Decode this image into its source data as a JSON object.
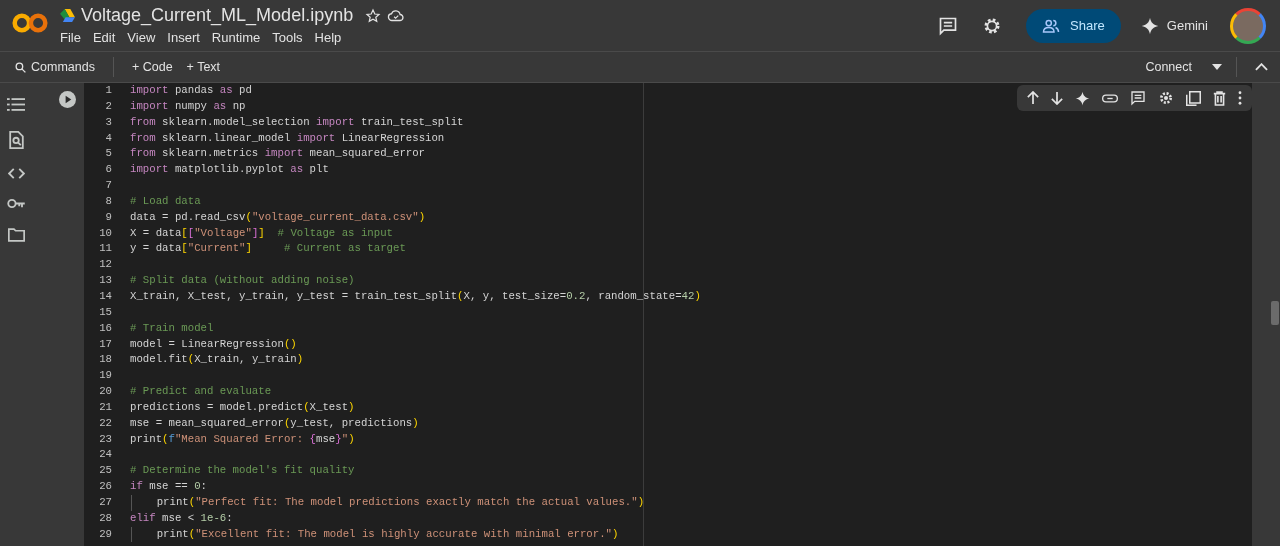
{
  "header": {
    "title": "Voltage_Current_ML_Model.ipynb",
    "menu": [
      "File",
      "Edit",
      "View",
      "Insert",
      "Runtime",
      "Tools",
      "Help"
    ],
    "share_label": "Share",
    "gemini_label": "Gemini"
  },
  "toolbar": {
    "commands_label": "Commands",
    "add_buttons": [
      "+ Code",
      "+ Text"
    ],
    "connect_label": "Connect"
  },
  "cell": {
    "lines": [
      {
        "number": "1",
        "tokens": [
          {
            "kind": "kw",
            "text": "import"
          },
          {
            "kind": "tx",
            "text": " pandas "
          },
          {
            "kind": "kw",
            "text": "as"
          },
          {
            "kind": "tx",
            "text": " pd"
          }
        ]
      },
      {
        "number": "2",
        "tokens": [
          {
            "kind": "kw",
            "text": "import"
          },
          {
            "kind": "tx",
            "text": " numpy "
          },
          {
            "kind": "kw",
            "text": "as"
          },
          {
            "kind": "tx",
            "text": " np"
          }
        ]
      },
      {
        "number": "3",
        "tokens": [
          {
            "kind": "kw",
            "text": "from"
          },
          {
            "kind": "tx",
            "text": " sklearn.model_selection "
          },
          {
            "kind": "kw",
            "text": "import"
          },
          {
            "kind": "tx",
            "text": " train_test_split"
          }
        ]
      },
      {
        "number": "4",
        "tokens": [
          {
            "kind": "kw",
            "text": "from"
          },
          {
            "kind": "tx",
            "text": " sklearn.linear_model "
          },
          {
            "kind": "kw",
            "text": "import"
          },
          {
            "kind": "tx",
            "text": " LinearRegression"
          }
        ]
      },
      {
        "number": "5",
        "tokens": [
          {
            "kind": "kw",
            "text": "from"
          },
          {
            "kind": "tx",
            "text": " sklearn.metrics "
          },
          {
            "kind": "kw",
            "text": "import"
          },
          {
            "kind": "tx",
            "text": " mean_squared_error"
          }
        ]
      },
      {
        "number": "6",
        "tokens": [
          {
            "kind": "kw",
            "text": "import"
          },
          {
            "kind": "tx",
            "text": " matplotlib.pyplot "
          },
          {
            "kind": "kw",
            "text": "as"
          },
          {
            "kind": "tx",
            "text": " plt"
          }
        ]
      },
      {
        "number": "7"
      },
      {
        "number": "8",
        "tokens": [
          {
            "kind": "cm",
            "text": "# Load data"
          }
        ]
      },
      {
        "number": "9",
        "tokens": [
          {
            "kind": "tx",
            "text": "data = pd.read_csv"
          },
          {
            "kind": "br",
            "text": "("
          },
          {
            "kind": "str",
            "text": "\"voltage_current_data.csv\""
          },
          {
            "kind": "br",
            "text": ")"
          }
        ]
      },
      {
        "number": "10",
        "tokens": [
          {
            "kind": "tx",
            "text": "X = data"
          },
          {
            "kind": "br",
            "text": "["
          },
          {
            "kind": "br2",
            "text": "["
          },
          {
            "kind": "str",
            "text": "\"Voltage\""
          },
          {
            "kind": "br2",
            "text": "]"
          },
          {
            "kind": "br",
            "text": "]"
          },
          {
            "kind": "cm",
            "text": "  # Voltage as input"
          }
        ]
      },
      {
        "number": "11",
        "tokens": [
          {
            "kind": "tx",
            "text": "y = data"
          },
          {
            "kind": "br",
            "text": "["
          },
          {
            "kind": "str",
            "text": "\"Current\""
          },
          {
            "kind": "br",
            "text": "]"
          },
          {
            "kind": "cm",
            "text": "     # Current as target"
          }
        ]
      },
      {
        "number": "12"
      },
      {
        "number": "13",
        "tokens": [
          {
            "kind": "cm",
            "text": "# Split data (without adding noise)"
          }
        ]
      },
      {
        "number": "14",
        "tokens": [
          {
            "kind": "tx",
            "text": "X_train, X_test, y_train, y_test = train_test_split"
          },
          {
            "kind": "br",
            "text": "("
          },
          {
            "kind": "tx",
            "text": "X, y, test_size="
          },
          {
            "kind": "num",
            "text": "0.2"
          },
          {
            "kind": "tx",
            "text": ", random_state="
          },
          {
            "kind": "num",
            "text": "42"
          },
          {
            "kind": "br",
            "text": ")"
          }
        ]
      },
      {
        "number": "15"
      },
      {
        "number": "16",
        "tokens": [
          {
            "kind": "cm",
            "text": "# Train model"
          }
        ]
      },
      {
        "number": "17",
        "tokens": [
          {
            "kind": "tx",
            "text": "model = LinearRegression"
          },
          {
            "kind": "br",
            "text": "()"
          }
        ]
      },
      {
        "number": "18",
        "tokens": [
          {
            "kind": "tx",
            "text": "model.fit"
          },
          {
            "kind": "br",
            "text": "("
          },
          {
            "kind": "tx",
            "text": "X_train, y_train"
          },
          {
            "kind": "br",
            "text": ")"
          }
        ]
      },
      {
        "number": "19"
      },
      {
        "number": "20",
        "tokens": [
          {
            "kind": "cm",
            "text": "# Predict and evaluate"
          }
        ]
      },
      {
        "number": "21",
        "tokens": [
          {
            "kind": "tx",
            "text": "predictions = model.predict"
          },
          {
            "kind": "br",
            "text": "("
          },
          {
            "kind": "tx",
            "text": "X_test"
          },
          {
            "kind": "br",
            "text": ")"
          }
        ]
      },
      {
        "number": "22",
        "tokens": [
          {
            "kind": "tx",
            "text": "mse = mean_squared_error"
          },
          {
            "kind": "br",
            "text": "("
          },
          {
            "kind": "tx",
            "text": "y_test, predictions"
          },
          {
            "kind": "br",
            "text": ")"
          }
        ]
      },
      {
        "number": "23",
        "tokens": [
          {
            "kind": "tx",
            "text": "print"
          },
          {
            "kind": "br",
            "text": "("
          },
          {
            "kind": "fs",
            "text": "f"
          },
          {
            "kind": "str",
            "text": "\"Mean Squared Error: "
          },
          {
            "kind": "br2",
            "text": "{"
          },
          {
            "kind": "tx",
            "text": "mse"
          },
          {
            "kind": "br2",
            "text": "}"
          },
          {
            "kind": "str",
            "text": "\""
          },
          {
            "kind": "br",
            "text": ")"
          }
        ]
      },
      {
        "number": "24"
      },
      {
        "number": "25",
        "tokens": [
          {
            "kind": "cm",
            "text": "# Determine the model's fit quality"
          }
        ]
      },
      {
        "number": "26",
        "tokens": [
          {
            "kind": "kw",
            "text": "if"
          },
          {
            "kind": "tx",
            "text": " mse == "
          },
          {
            "kind": "num",
            "text": "0"
          },
          {
            "kind": "tx",
            "text": ":"
          }
        ]
      },
      {
        "number": "27",
        "indented": true,
        "tokens": [
          {
            "kind": "tx",
            "text": "print"
          },
          {
            "kind": "br",
            "text": "("
          },
          {
            "kind": "str",
            "text": "\"Perfect fit: The model predictions exactly match the actual values.\""
          },
          {
            "kind": "br",
            "text": ")"
          }
        ]
      },
      {
        "number": "28",
        "tokens": [
          {
            "kind": "kw",
            "text": "elif"
          },
          {
            "kind": "tx",
            "text": " mse < "
          },
          {
            "kind": "num",
            "text": "1e-6"
          },
          {
            "kind": "tx",
            "text": ":"
          }
        ]
      },
      {
        "number": "29",
        "indented": true,
        "tokens": [
          {
            "kind": "tx",
            "text": "print"
          },
          {
            "kind": "br",
            "text": "("
          },
          {
            "kind": "str",
            "text": "\"Excellent fit: The model is highly accurate with minimal error.\""
          },
          {
            "kind": "br",
            "text": ")"
          }
        ]
      }
    ]
  }
}
